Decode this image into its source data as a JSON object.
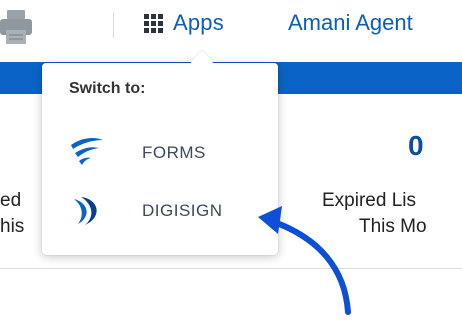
{
  "header": {
    "apps_label": "Apps",
    "user_name": "Amani Agent"
  },
  "stats": {
    "right_value": "0",
    "left_line1": "ed",
    "left_line2": "his",
    "right_line1": "Expired Lis",
    "right_line2": "This Mo"
  },
  "dropdown": {
    "heading": "Switch to:",
    "items": [
      {
        "label": "FORMS",
        "icon": "forms-logo-icon"
      },
      {
        "label": "DIGISIGN",
        "icon": "digisign-logo-icon"
      }
    ]
  },
  "colors": {
    "brand_blue": "#0a63c7",
    "link_blue": "#0d5eb8",
    "annotation_arrow": "#0d4fd6"
  }
}
